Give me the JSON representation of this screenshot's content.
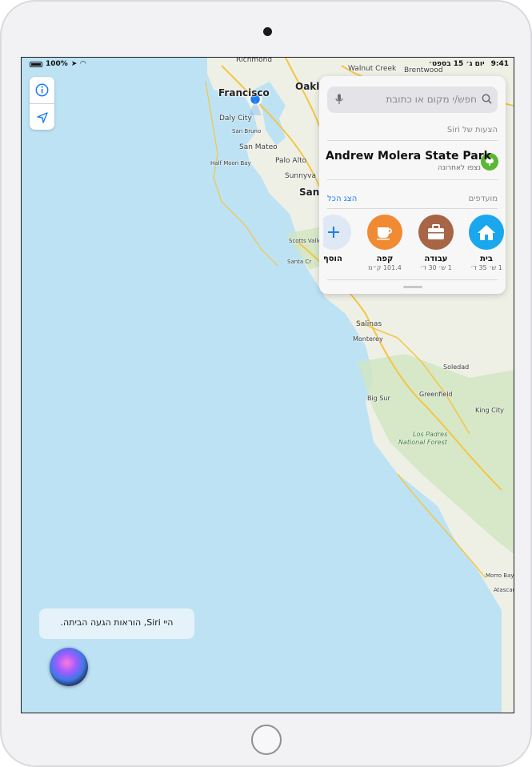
{
  "status_bar": {
    "time": "9:41",
    "date": "יום ג׳ 15 בספט׳",
    "battery": "100%"
  },
  "map_labels": [
    {
      "text": "Richmond",
      "kind": "city"
    },
    {
      "text": "Walnut Creek",
      "kind": "city"
    },
    {
      "text": "Brentwood",
      "kind": "city"
    },
    {
      "text": "Oakla",
      "kind": "big"
    },
    {
      "text": "Francisco",
      "kind": "big"
    },
    {
      "text": "Daly City",
      "kind": "city"
    },
    {
      "text": "San Bruno",
      "kind": "city"
    },
    {
      "text": "San Mateo",
      "kind": "city"
    },
    {
      "text": "Half Moon Bay",
      "kind": "city"
    },
    {
      "text": "Palo Alto",
      "kind": "city"
    },
    {
      "text": "Sunnyva",
      "kind": "city"
    },
    {
      "text": "San",
      "kind": "big"
    },
    {
      "text": "Scotts Valle",
      "kind": "city"
    },
    {
      "text": "Santa Cr",
      "kind": "city"
    },
    {
      "text": "Salinas",
      "kind": "city"
    },
    {
      "text": "Monterey",
      "kind": "city"
    },
    {
      "text": "Soledad",
      "kind": "city"
    },
    {
      "text": "Greenfield",
      "kind": "city"
    },
    {
      "text": "Big Sur",
      "kind": "city"
    },
    {
      "text": "King City",
      "kind": "city"
    },
    {
      "text": "Los Padres",
      "kind": "park"
    },
    {
      "text": "National Forest",
      "kind": "park"
    },
    {
      "text": "Morro Bay",
      "kind": "city"
    },
    {
      "text": "Atascadero",
      "kind": "city"
    }
  ],
  "panel": {
    "search_placeholder": "חפש/י מקום או כתובת",
    "siri_suggestions_label": "הצעות של Siri",
    "suggestion": {
      "title": "Andrew Molera State Park",
      "subtitle": "נצפו לאחרונה"
    },
    "favorites_label": "מועדפים",
    "see_all": "הצג הכל",
    "favorites": [
      {
        "name": "בית",
        "detail": "1 ש׳ 35 ד׳",
        "color": "#1aa7ee",
        "icon": "home-icon"
      },
      {
        "name": "עבודה",
        "detail": "1 ש׳ 30 ד׳",
        "color": "#a76545",
        "icon": "briefcase-icon"
      },
      {
        "name": "קפה",
        "detail": "101.4 ק״מ",
        "color": "#f08a33",
        "icon": "coffee-icon"
      },
      {
        "name": "הוסף",
        "detail": "",
        "color": "#dfe9f6",
        "icon": "plus-icon"
      }
    ]
  },
  "siri": {
    "utterance": "היי Siri, הוראות הגעה הביתה."
  }
}
